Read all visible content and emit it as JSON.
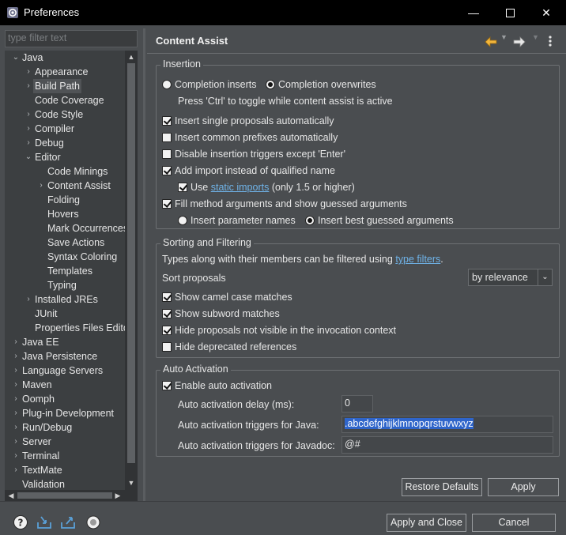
{
  "window": {
    "title": "Preferences",
    "minimize_glyph": "—",
    "maximize_glyph": "☐",
    "close_glyph": "✕"
  },
  "sidebar": {
    "filter_placeholder": "type filter text",
    "items": [
      {
        "label": "Java",
        "twisty": "⌄"
      },
      {
        "label": "Appearance",
        "twisty": "›"
      },
      {
        "label": "Build Path",
        "twisty": "›"
      },
      {
        "label": "Code Coverage",
        "twisty": ""
      },
      {
        "label": "Code Style",
        "twisty": "›"
      },
      {
        "label": "Compiler",
        "twisty": "›"
      },
      {
        "label": "Debug",
        "twisty": "›"
      },
      {
        "label": "Editor",
        "twisty": "⌄"
      },
      {
        "label": "Code Minings",
        "twisty": ""
      },
      {
        "label": "Content Assist",
        "twisty": "›"
      },
      {
        "label": "Folding",
        "twisty": ""
      },
      {
        "label": "Hovers",
        "twisty": ""
      },
      {
        "label": "Mark Occurrences",
        "twisty": ""
      },
      {
        "label": "Save Actions",
        "twisty": ""
      },
      {
        "label": "Syntax Coloring",
        "twisty": ""
      },
      {
        "label": "Templates",
        "twisty": ""
      },
      {
        "label": "Typing",
        "twisty": ""
      },
      {
        "label": "Installed JREs",
        "twisty": "›"
      },
      {
        "label": "JUnit",
        "twisty": ""
      },
      {
        "label": "Properties Files Editor",
        "twisty": ""
      },
      {
        "label": "Java EE",
        "twisty": "›"
      },
      {
        "label": "Java Persistence",
        "twisty": "›"
      },
      {
        "label": "Language Servers",
        "twisty": "›"
      },
      {
        "label": "Maven",
        "twisty": "›"
      },
      {
        "label": "Oomph",
        "twisty": "›"
      },
      {
        "label": "Plug-in Development",
        "twisty": "›"
      },
      {
        "label": "Run/Debug",
        "twisty": "›"
      },
      {
        "label": "Server",
        "twisty": "›"
      },
      {
        "label": "Terminal",
        "twisty": "›"
      },
      {
        "label": "TextMate",
        "twisty": "›"
      },
      {
        "label": "Validation",
        "twisty": ""
      }
    ]
  },
  "page": {
    "title": "Content Assist",
    "insertion": {
      "label": "Insertion",
      "completion_inserts": "Completion inserts",
      "completion_overwrites": "Completion overwrites",
      "toggle_hint": "Press 'Ctrl' to toggle while content assist is active",
      "insert_single": "Insert single proposals automatically",
      "insert_common": "Insert common prefixes automatically",
      "disable_triggers": "Disable insertion triggers except 'Enter'",
      "add_import": "Add import instead of qualified name",
      "use_label": "Use",
      "static_imports": "static imports",
      "static_suffix": "(only 1.5 or higher)",
      "fill_method_args": "Fill method arguments and show guessed arguments",
      "insert_param_names": "Insert parameter names",
      "insert_best_guessed": "Insert best guessed arguments"
    },
    "sorting": {
      "label": "Sorting and Filtering",
      "types_text": "Types along with their members can be filtered using",
      "type_filters_link": "type filters",
      "period": ".",
      "sort_proposals": "Sort proposals",
      "sort_value": "by relevance",
      "camel_case": "Show camel case matches",
      "subword": "Show subword matches",
      "hide_not_visible": "Hide proposals not visible in the invocation context",
      "hide_deprecated": "Hide deprecated references"
    },
    "auto_activation": {
      "label": "Auto Activation",
      "enable": "Enable auto activation",
      "delay_label": "Auto activation delay (ms):",
      "delay_value": "0",
      "java_triggers_label": "Auto activation triggers for Java:",
      "java_triggers_value": ".abcdefghijklmnopqrstuvwxyz",
      "javadoc_triggers_label": "Auto activation triggers for Javadoc:",
      "javadoc_triggers_value": "@#"
    },
    "restore_defaults": "Restore Defaults",
    "apply": "Apply"
  },
  "footer": {
    "apply_and_close": "Apply and Close",
    "cancel": "Cancel"
  },
  "colors": {
    "accent_selection": "#2f65ca",
    "link": "#6fb3e8",
    "background": "#4a4d50"
  }
}
